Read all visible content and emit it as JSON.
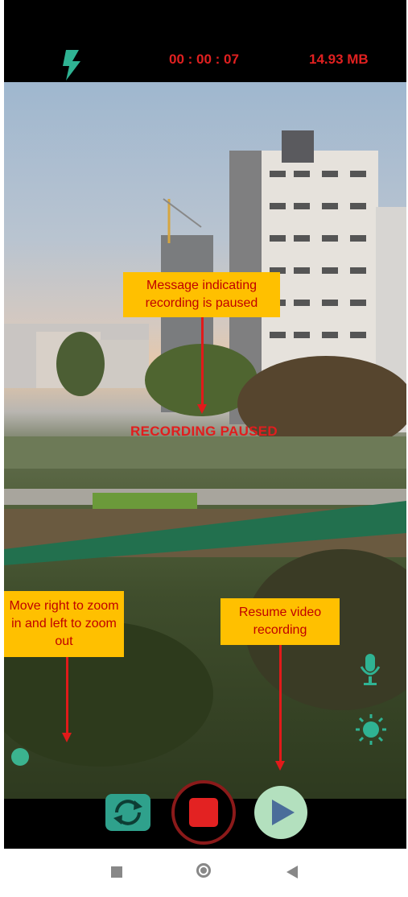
{
  "status": {
    "timer": "00 : 00 : 07",
    "file_size": "14.93 MB",
    "flash_icon": "flash-icon"
  },
  "overlay": {
    "paused_message": "RECORDING PAUSED"
  },
  "callouts": {
    "paused_note": "Message indicating recording is paused",
    "zoom_note": "Move right to zoom in and left to zoom out",
    "resume_note": "Resume video recording"
  },
  "controls": {
    "flip_camera_icon": "camera-flip-icon",
    "stop_icon": "stop-icon",
    "resume_icon": "play-icon",
    "mic_icon": "microphone-icon",
    "brightness_icon": "brightness-icon"
  },
  "nav": {
    "recents": "square-icon",
    "home": "circle-icon",
    "back": "triangle-back-icon"
  },
  "colors": {
    "accent": "#2fa18c",
    "alert": "#e02020",
    "callout_bg": "#ffc000",
    "callout_text": "#c00000"
  }
}
